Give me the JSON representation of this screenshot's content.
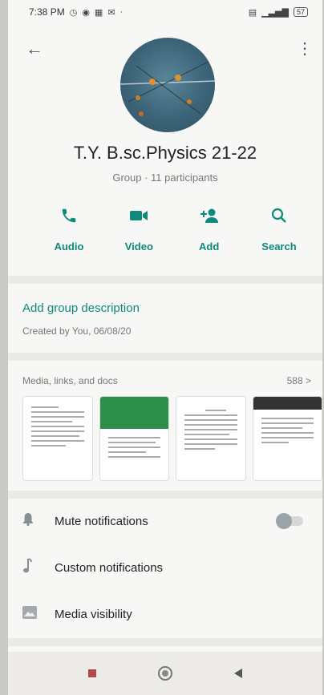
{
  "status_bar": {
    "time": "7:38 PM",
    "signal": "▁▃▅▇",
    "battery": "57"
  },
  "group": {
    "name": "T.Y. B.sc.Physics 21-22",
    "meta": "Group · 11 participants"
  },
  "actions": [
    {
      "label": "Audio",
      "icon": "phone-icon"
    },
    {
      "label": "Video",
      "icon": "video-icon"
    },
    {
      "label": "Add",
      "icon": "add-user-icon"
    },
    {
      "label": "Search",
      "icon": "search-icon"
    }
  ],
  "description": {
    "add_label": "Add group description",
    "created": "Created by You, 06/08/20"
  },
  "media": {
    "label": "Media, links, and docs",
    "count": "588 >"
  },
  "settings": [
    {
      "label": "Mute notifications",
      "icon": "bell-icon"
    },
    {
      "label": "Custom notifications",
      "icon": "music-note-icon"
    },
    {
      "label": "Media visibility",
      "icon": "image-icon"
    }
  ],
  "colors": {
    "accent": "#0e8a7d",
    "background": "#f7f7f5"
  }
}
